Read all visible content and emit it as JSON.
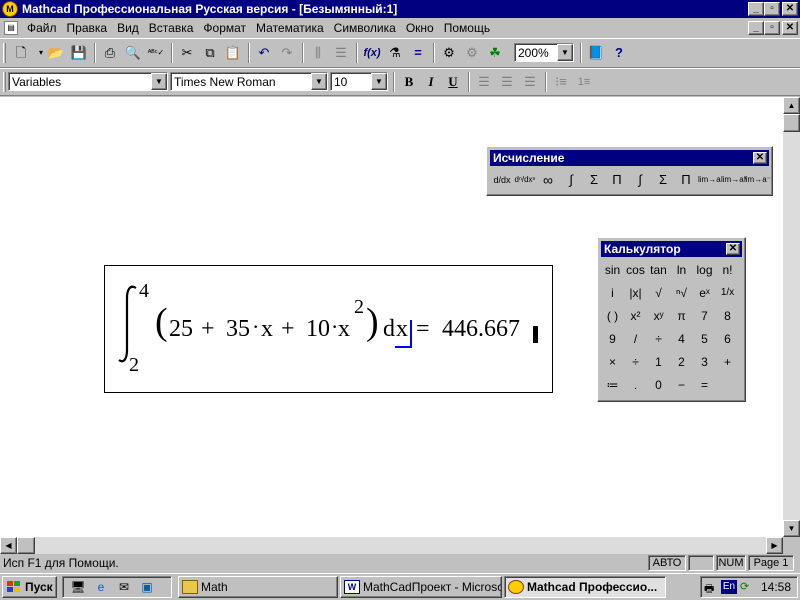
{
  "window": {
    "title": "Mathcad Профессиональная Русская версия - [Безымянный:1]",
    "app_icon": "mathcad-icon"
  },
  "menu": [
    "Файл",
    "Правка",
    "Вид",
    "Вставка",
    "Формат",
    "Математика",
    "Символика",
    "Окно",
    "Помощь"
  ],
  "toolbar": {
    "zoom": "200%",
    "buttons": [
      "new-icon",
      "open-icon",
      "save-icon",
      "print-icon",
      "print-preview-icon",
      "spell-check-icon",
      "cut-icon",
      "copy-icon",
      "paste-icon",
      "undo-icon",
      "redo-icon",
      "align-across-icon",
      "align-down-icon",
      "insert-function-icon",
      "insert-unit-icon",
      "calculate-icon",
      "insert-component-icon",
      "resource-icon",
      "help-icon"
    ]
  },
  "format_bar": {
    "style": "Variables",
    "font": "Times New Roman",
    "size": "10",
    "bold": "B",
    "italic": "I",
    "underline": "U"
  },
  "formula": {
    "upper_limit": "4",
    "lower_limit": "2",
    "open_paren": "(",
    "c1": "25",
    "plus1": "+",
    "c2": "35",
    "dot1": "·",
    "var1": "x",
    "plus2": "+",
    "c3": "10",
    "dot2": "·",
    "var2": "x",
    "exponent": "2",
    "close_paren": ")",
    "d": "d",
    "dvar": "x",
    "equals": "=",
    "result": "446.667"
  },
  "calculus_palette": {
    "title": "Исчисление",
    "icons": [
      "derivative-icon",
      "nth-derivative-icon",
      "infinity-icon",
      "definite-integral-icon",
      "range-sum-icon",
      "range-product-icon",
      "indefinite-integral-icon",
      "summation-icon",
      "product-icon",
      "limit-icon",
      "right-limit-icon",
      "left-limit-icon"
    ]
  },
  "calculator_palette": {
    "title": "Калькулятор",
    "rows": [
      [
        "sin",
        "cos",
        "tan",
        "ln",
        "log",
        "n!"
      ],
      [
        "i",
        "|x|",
        "√",
        "ⁿ√",
        "eˣ",
        "1/x"
      ],
      [
        "( )",
        "x²",
        "xʸ",
        "π",
        "7",
        "8"
      ],
      [
        "9",
        "/",
        "÷",
        "4",
        "5",
        "6"
      ],
      [
        "×",
        "÷",
        "1",
        "2",
        "3",
        "+"
      ],
      [
        "≔",
        ".",
        "0",
        "−",
        "="
      ]
    ]
  },
  "status": {
    "help_text": "Исп F1 для Помощи.",
    "mode": "АВТО",
    "num": "NUM",
    "page": "Page 1"
  },
  "taskbar": {
    "start": "Пуск",
    "tasks": [
      {
        "label": "Math",
        "icon": "folder-icon"
      },
      {
        "label": "MathCadПроект - Microso...",
        "icon": "word-icon"
      },
      {
        "label": "Mathcad Профессио...",
        "icon": "mathcad-icon"
      }
    ],
    "language": "En",
    "clock": "14:58"
  }
}
